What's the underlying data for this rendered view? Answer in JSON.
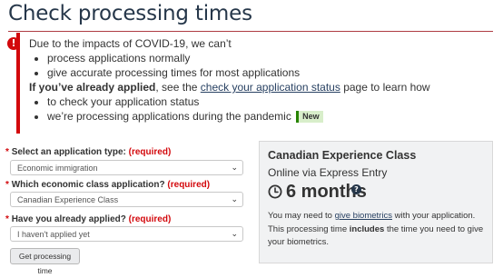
{
  "page": {
    "title": "Check processing times"
  },
  "alert": {
    "icon": "exclamation-icon",
    "color": "#d3080c",
    "intro": "Due to the impacts of COVID-19, we can’t",
    "bullets": [
      "process applications normally",
      "give accurate processing times for most applications"
    ],
    "applied_lead": "If you’ve already applied",
    "applied_mid": ", see the ",
    "status_link": "check your application status",
    "applied_tail": " page to learn how",
    "bullets2": [
      "to check your application status",
      "we’re processing applications during the pandemic"
    ],
    "new_badge": "New"
  },
  "form": {
    "required_mark": "*",
    "required_text": "(required)",
    "fields": [
      {
        "label": "Select an application type:",
        "value": "Economic immigration"
      },
      {
        "label": "Which economic class application?",
        "value": "Canadian Experience Class"
      },
      {
        "label": "Have you already applied?",
        "value": "I haven't applied yet"
      }
    ],
    "chevron_icon": "chevron-down-icon",
    "submit_label": "Get processing time"
  },
  "result": {
    "title": "Canadian Experience Class",
    "subtitle": "Online via Express Entry",
    "clock_icon": "clock-icon",
    "time": "6 months",
    "help_icon": "question-circle-icon",
    "body_pre": "You may need to ",
    "body_link": "give biometrics",
    "body_mid": " with your application. This processing time ",
    "body_bold": "includes",
    "body_post": " the time you need to give your biometrics."
  }
}
